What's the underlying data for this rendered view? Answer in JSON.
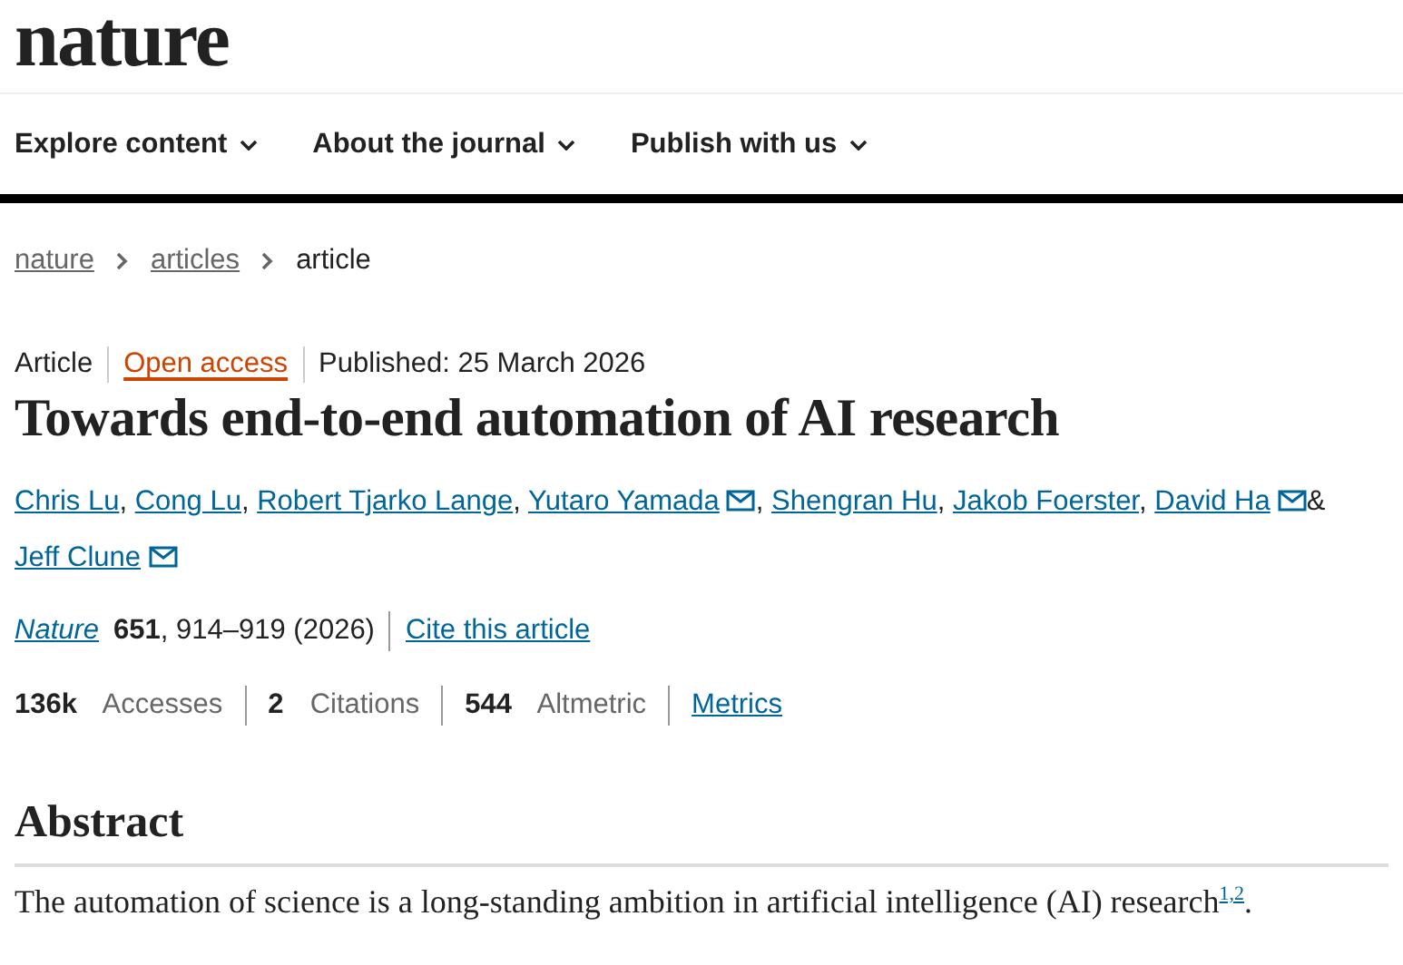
{
  "logo": "nature",
  "nav": [
    {
      "label": "Explore content"
    },
    {
      "label": "About the journal"
    },
    {
      "label": "Publish with us"
    }
  ],
  "breadcrumbs": [
    {
      "label": "nature",
      "link": true
    },
    {
      "label": "articles",
      "link": true
    },
    {
      "label": "article",
      "link": false
    }
  ],
  "article_type": "Article",
  "access": "Open access",
  "published": "Published: 25 March 2026",
  "title": "Towards end-to-end automation of AI research",
  "authors": [
    {
      "name": "Chris Lu",
      "email": false,
      "separator": ","
    },
    {
      "name": "Cong Lu",
      "email": false,
      "separator": ","
    },
    {
      "name": "Robert Tjarko Lange",
      "email": false,
      "separator": ","
    },
    {
      "name": "Yutaro Yamada",
      "email": true,
      "separator": ","
    },
    {
      "name": "Shengran Hu",
      "email": false,
      "separator": ","
    },
    {
      "name": "Jakob Foerster",
      "email": false,
      "separator": ","
    },
    {
      "name": "David Ha",
      "email": true,
      "separator": "&"
    },
    {
      "name": "Jeff Clune",
      "email": true
    }
  ],
  "citation": {
    "journal": "Nature",
    "volume": "651",
    "pages": ", 914–919 (2026)",
    "cite_link": "Cite this article"
  },
  "metrics": [
    "**136k**  Accesses",
    "**2**  Citations",
    "**544**  Altmetric"
  ],
  "metrics_link": "Metrics",
  "abstract": {
    "heading": "Abstract",
    "text": "The automation of science is a long-standing ambition in artificial intelligence (AI) research$^{1,2}$."
  }
}
